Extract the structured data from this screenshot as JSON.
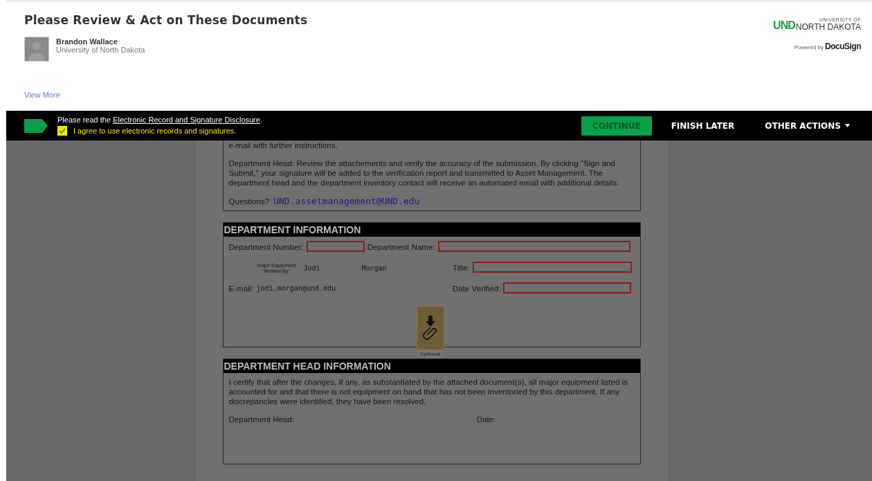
{
  "header": {
    "title": "Please Review & Act on These Documents",
    "sender": {
      "name": "Brandon Wallace",
      "organization": "University of North Dakota"
    },
    "view_more": "View More",
    "logo": {
      "mark": "UND",
      "small": "UNIVERSITY OF",
      "large": "NORTH DAKOTA"
    },
    "powered_by": {
      "prefix": "Powered by",
      "brand": "DocuSign"
    }
  },
  "action_bar": {
    "notice_prefix": "Please read the ",
    "notice_link": "Electronic Record and Signature Disclosure",
    "notice_suffix": ".",
    "agree": {
      "label": "I agree to use electronic records and signatures.",
      "checked": true
    },
    "buttons": [
      {
        "kind": "primary",
        "label": "CONTINUE"
      },
      {
        "kind": "plain",
        "label": "FINISH LATER"
      },
      {
        "kind": "menu",
        "label": "OTHER ACTIONS"
      }
    ]
  },
  "document": {
    "intro": {
      "line": "e-mail with further instructions.",
      "paragraph": "Department Head: Review the attachements and verify the accuracy of the submission. By clicking \"Sign and Submit,\" your signature will be added to the verification report and transmitted to Asset Management. The department head and the department inventory contact will receive an automated email with additional details.",
      "questions_label": "Questions?",
      "questions_email": "UND.assetmanagement@UND.edu"
    },
    "department_information": {
      "heading": "DEPARTMENT INFORMATION",
      "department_number_label": "Department Number:",
      "department_name_label": "Department Name:",
      "verified_by_label": "Major Equipment Verified By:",
      "first_name": "Jodi",
      "last_name": "Morgan",
      "title_label": "Title:",
      "email_label": "E-mail:",
      "email": "jodi.morgan@und.edu",
      "date_verified_label": "Date Verified:",
      "attachment": {
        "caption": "Optional"
      }
    },
    "department_head_information": {
      "heading": "DEPARTMENT HEAD INFORMATION",
      "statement": "I certify that after the changes, if any, as substantiated by the attached document(s), all major equipment listed is accounted for and that there is not equipment on hand that has not been inventoried by this department. If any discrepancies were identified, they have been resolved.",
      "head_label": "Department Head:",
      "date_label": "Date:"
    }
  }
}
